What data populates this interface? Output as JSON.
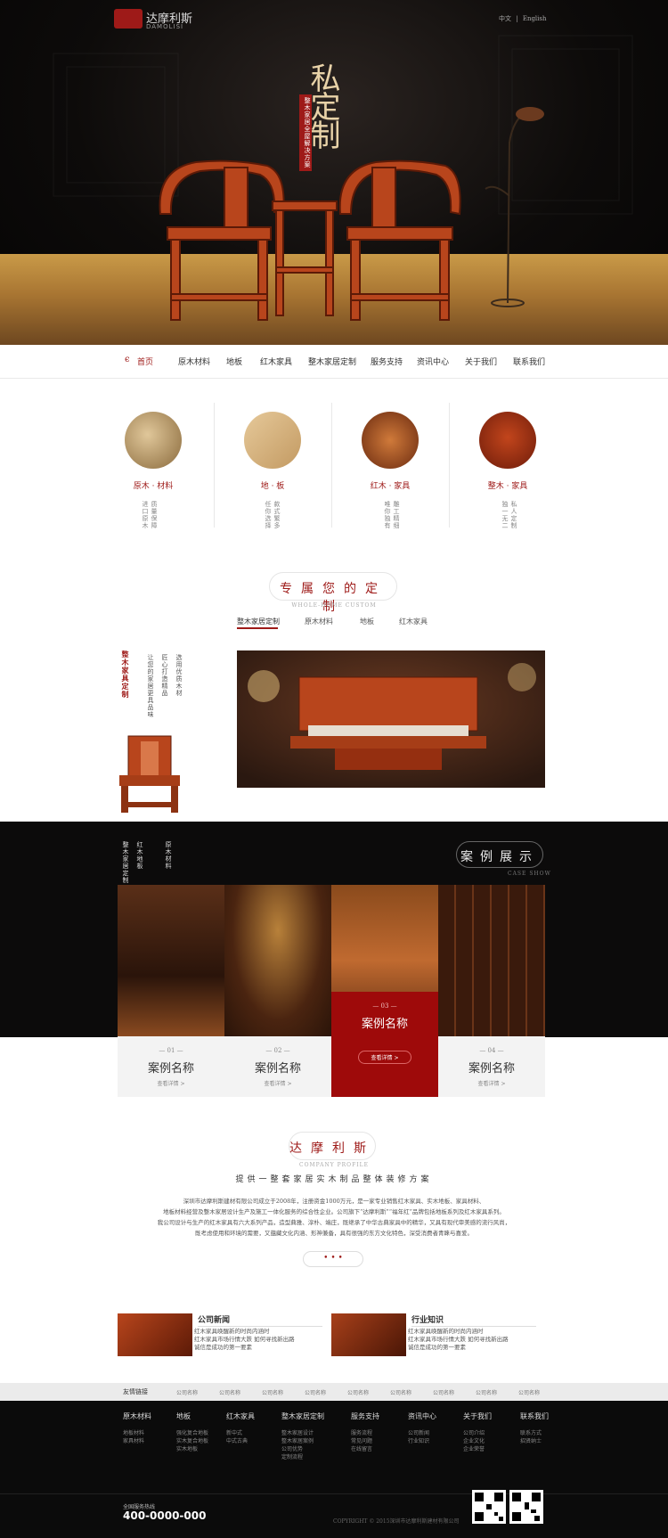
{
  "brand": {
    "name_cn": "达摩利斯",
    "name_en": "DAMOLISI"
  },
  "lang": {
    "cn": "中文",
    "sep": "|",
    "en": "English"
  },
  "hero": {
    "title": "私定制",
    "subtitle_vertical": "整木家居全屋解决方案"
  },
  "nav": {
    "items": [
      "首页",
      "原木材料",
      "地板",
      "红木家具",
      "整木家居定制",
      "服务支持",
      "资讯中心",
      "关于我们",
      "联系我们"
    ]
  },
  "categories": [
    {
      "title": "原木 · 材料",
      "desc": [
        "进口原木",
        "质量保障"
      ]
    },
    {
      "title": "地 · 板",
      "desc": [
        "款式繁多",
        "任你选择"
      ]
    },
    {
      "title": "红木 · 家具",
      "desc": [
        "雕工精细",
        "唯你独有"
      ]
    },
    {
      "title": "整木 · 家具",
      "desc": [
        "私人定制",
        "独一无二"
      ]
    }
  ],
  "custom": {
    "title": "专属您的定制",
    "subtitle": "WHOLE-HOME CUSTOM",
    "tabs": [
      "整木家居定制",
      "原木材料",
      "地板",
      "红木家具"
    ],
    "side_title": "整木家具定制",
    "side_lines": [
      "选用优质木材",
      "匠心打造精品",
      "让您的家居更具品味"
    ]
  },
  "cases": {
    "title": "案例展示",
    "subtitle": "CASE SHOW",
    "side_tabs": [
      "原木材料",
      "红木地板",
      "整木家居定制"
    ],
    "items": [
      {
        "num": "— 01 —",
        "name": "案例名称",
        "more": "查看详情 >"
      },
      {
        "num": "— 02 —",
        "name": "案例名称",
        "more": "查看详情 >"
      },
      {
        "num": "— 03 —",
        "name": "案例名称",
        "more": "查看详情 >"
      },
      {
        "num": "— 04 —",
        "name": "案例名称",
        "more": "查看详情 >"
      }
    ]
  },
  "about": {
    "title": "达摩利斯",
    "subtitle": "COMPANY PROFILE",
    "tagline": "提供一整套家居实木制品整体装修方案",
    "body1": "深圳市达摩利斯建材有限公司成立于2008年，注册资金1000万元，是一家专业销售红木家具、实木地板、家具材料、",
    "body2": "地板材料经营及整木家居设计生产及施工一体化服务的综合性企业。公司旗下“达摩利斯”“福年红”品牌包括地板系列及红木家具系列。",
    "body3": "我公司设计与生产的红木家具有六大系列产品，造型典雅、淳朴、端庄，既继承了中华古典家具中的精华，又具有现代审美感的流行风尚，",
    "body4": "既考虑使用和环境的需要，又蕴藏文化内涵、形神兼备，具有很强的东方文化特色，深受消费者青睐与喜爱。",
    "more": "• • •"
  },
  "news": [
    {
      "title": "公司新闻",
      "items": [
        "红木家具唤醒新的时尚内涵时",
        "红木家具市场行情大跌 如何寻找新出路",
        "诚信是成功的第一要素"
      ]
    },
    {
      "title": "行业知识",
      "items": [
        "红木家具唤醒新的时尚内涵时",
        "红木家具市场行情大跌 如何寻找新出路",
        "诚信是成功的第一要素"
      ]
    }
  ],
  "links": {
    "label": "友情链接",
    "items": [
      "公司名称",
      "公司名称",
      "公司名称",
      "公司名称",
      "公司名称",
      "公司名称",
      "公司名称",
      "公司名称",
      "公司名称"
    ]
  },
  "footer": {
    "cols": [
      {
        "head": "原木材料",
        "items": [
          "地板材料",
          "家具材料"
        ]
      },
      {
        "head": "地板",
        "items": [
          "强化复合地板",
          "实木复合地板",
          "实木地板"
        ]
      },
      {
        "head": "红木家具",
        "items": [
          "新中式",
          "中式古典"
        ]
      },
      {
        "head": "整木家居定制",
        "items": [
          "整木家居设计",
          "整木家居案例",
          "公司优势",
          "定制流程"
        ]
      },
      {
        "head": "服务支持",
        "items": [
          "服务流程",
          "常见问题",
          "在线留言"
        ]
      },
      {
        "head": "资讯中心",
        "items": [
          "公司新闻",
          "行业知识"
        ]
      },
      {
        "head": "关于我们",
        "items": [
          "公司介绍",
          "企业文化",
          "企业荣誉"
        ]
      },
      {
        "head": "联系我们",
        "items": [
          "联系方式",
          "招贤纳士"
        ]
      }
    ],
    "hotline_label": "全国服务热线",
    "hotline": "400-0000-000",
    "copyright": "COPYRIGHT © 2015深圳市达摩利斯建材有限公司"
  },
  "colors": {
    "accent": "#9e1a18",
    "dark": "#0c0b0b",
    "wood": "#b8451c"
  }
}
